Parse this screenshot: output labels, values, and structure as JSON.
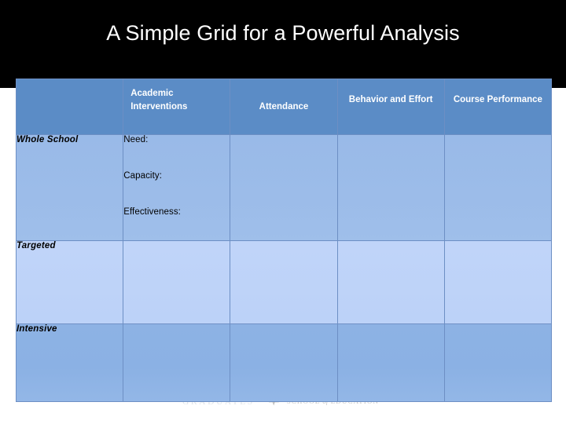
{
  "slide": {
    "title": "A Simple Grid for a Powerful Analysis",
    "title_color": "#FFFFFF",
    "band_color": "#000000",
    "background_color": "#FFFFFF"
  },
  "table": {
    "header_bg": "#5B8CC6",
    "header_text_color": "#FFFFFF",
    "border_color": "#6D8FC4",
    "headers": [
      {
        "label": "",
        "align": "left"
      },
      {
        "label": "Academic Interventions",
        "align": "left"
      },
      {
        "label": "Attendance",
        "align": "center"
      },
      {
        "label": "Behavior and Effort",
        "align": "center"
      },
      {
        "label": "Course Performance",
        "align": "center"
      }
    ],
    "rows": [
      {
        "label": "Whole School",
        "row_bg": "#9CBCE8",
        "cells": [
          {
            "lines": [
              "Need:",
              "Capacity:",
              "Effectiveness:"
            ]
          },
          {
            "lines": []
          },
          {
            "lines": []
          },
          {
            "lines": []
          }
        ]
      },
      {
        "label": "Targeted",
        "row_bg": "#BDD3F7",
        "cells": [
          {
            "lines": []
          },
          {
            "lines": []
          },
          {
            "lines": []
          },
          {
            "lines": []
          }
        ]
      },
      {
        "label": "Intensive",
        "row_bg": "#8FB3E5",
        "cells": [
          {
            "lines": []
          },
          {
            "lines": []
          },
          {
            "lines": []
          },
          {
            "lines": []
          }
        ]
      }
    ]
  },
  "watermark": {
    "word": "GRADUATES",
    "registered_mark": "®",
    "school_pre": "SCHOOL ",
    "school_of": "of",
    "school_post": " EDUCATION"
  }
}
